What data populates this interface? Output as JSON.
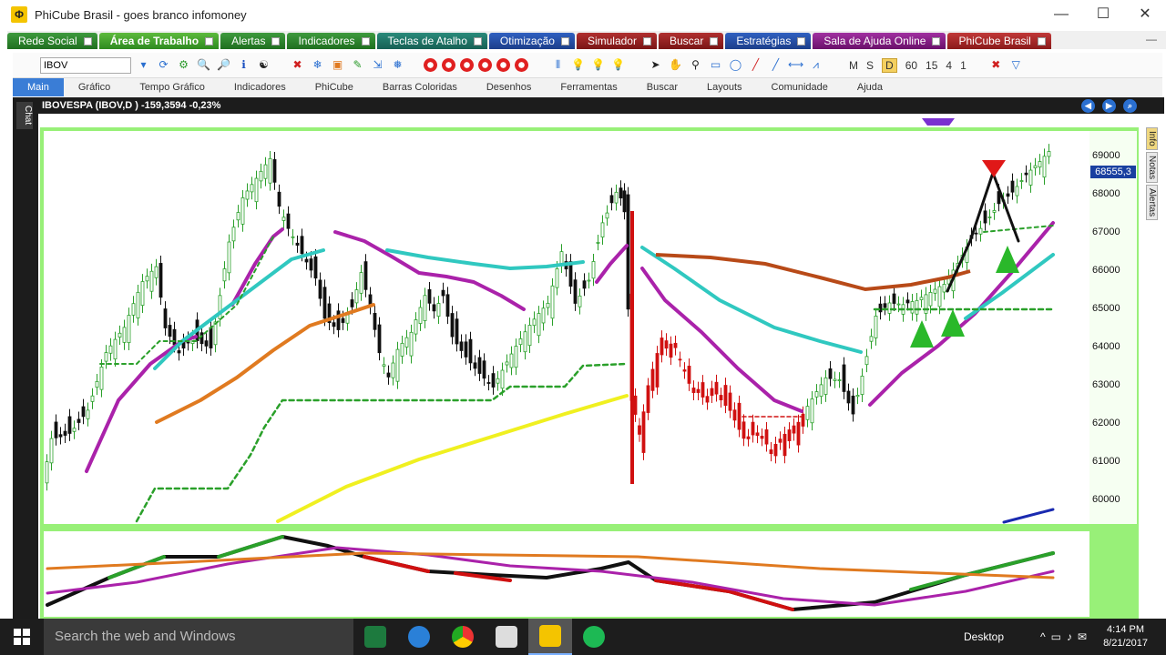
{
  "window": {
    "title": "PhiCube Brasil - goes branco infomoney",
    "logo": "phicube-logo-icon",
    "controls": [
      "—",
      "☐",
      "✕"
    ]
  },
  "menu_tabs": [
    {
      "label": "Rede Social",
      "color": "g"
    },
    {
      "label": "Área de Trabalho",
      "color": "active"
    },
    {
      "label": "Alertas",
      "color": "g"
    },
    {
      "label": "Indicadores",
      "color": "g"
    },
    {
      "label": "Teclas de Atalho",
      "color": "t"
    },
    {
      "label": "Otimização",
      "color": "b"
    },
    {
      "label": "Simulador",
      "color": "r"
    },
    {
      "label": "Buscar",
      "color": "r"
    },
    {
      "label": "Estratégias",
      "color": "b"
    },
    {
      "label": "Sala de Ajuda Online",
      "color": "p"
    },
    {
      "label": "PhiCube Brasil",
      "color": "rb"
    }
  ],
  "toolbar": {
    "symbol_value": "IBOV",
    "periods": [
      "M",
      "S",
      "D",
      "60",
      "15",
      "4",
      "1"
    ],
    "period_selected": "D"
  },
  "ribbon_tabs": [
    "Main",
    "Gráfico",
    "Tempo Gráfico",
    "Indicadores",
    "PhiCube",
    "Barras Coloridas",
    "Desenhos",
    "Ferramentas",
    "Buscar",
    "Layouts",
    "Comunidade",
    "Ajuda"
  ],
  "chart_header": {
    "text": "IBOVESPA (IBOV,D ) -159,3594 -0,23%"
  },
  "chat_tab": "Chat",
  "side_tabs": [
    "Info",
    "Notas",
    "Alertas"
  ],
  "price_axis": {
    "current": "68555,3",
    "ticks": [
      "69000",
      "68000",
      "67000",
      "66000",
      "65000",
      "64000",
      "63000",
      "62000",
      "61000",
      "60000"
    ]
  },
  "colors": {
    "up": "#2aa02a",
    "down": "#111111",
    "big_down": "#d01010",
    "magenta": "#aa22aa",
    "cyan": "#30c8c0",
    "orange": "#e07a20",
    "yellow": "#f0f020",
    "frame": "#98f078"
  },
  "taskbar": {
    "search_placeholder": "Search the web and Windows",
    "desktop": "Desktop",
    "time": "4:14 PM",
    "date": "8/21/2017"
  }
}
